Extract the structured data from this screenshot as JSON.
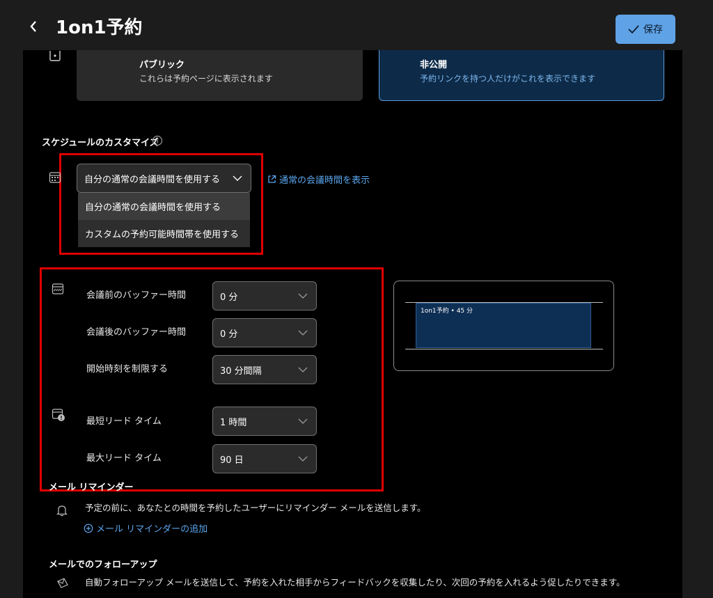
{
  "header": {
    "back_label": "<",
    "title": "1on1予約",
    "save_label": "保存"
  },
  "visibility": {
    "public_title": "パブリック",
    "public_desc": "これらは予約ページに表示されます",
    "private_title": "非公開",
    "private_desc": "予約リンクを持つ人だけがこれを表示できます"
  },
  "schedule": {
    "heading": "スケジュールのカスタマイズ",
    "selected": "自分の通常の会議時間を使用する",
    "options": [
      "自分の通常の会議時間を使用する",
      "カスタムの予約可能時間帯を使用する"
    ],
    "link": "通常の会議時間を表示"
  },
  "buffers": {
    "before_label": "会議前のバッファー時間",
    "before_value": "0 分",
    "after_label": "会議後のバッファー時間",
    "after_value": "0 分",
    "start_label": "開始時刻を制限する",
    "start_value": "30 分間隔",
    "min_lead_label": "最短リード タイム",
    "min_lead_value": "1 時間",
    "max_lead_label": "最大リード タイム",
    "max_lead_value": "90 日"
  },
  "preview": {
    "event_label": "1on1予約 • 45 分"
  },
  "reminder": {
    "heading": "メール リマインダー",
    "desc": "予定の前に、あなたとの時間を予約したユーザーにリマインダー メールを送信します。",
    "add_link": "メール リマインダーの追加"
  },
  "followup": {
    "heading": "メールでのフォローアップ",
    "desc": "自動フォローアップ メールを送信して、予約を入れた相手からフィードバックを収集したり、次回の予約を入れるよう促したりできます。"
  },
  "colors": {
    "accent": "#5fa2e6",
    "highlight_box": "#e00000",
    "link": "#5aa6ee"
  }
}
